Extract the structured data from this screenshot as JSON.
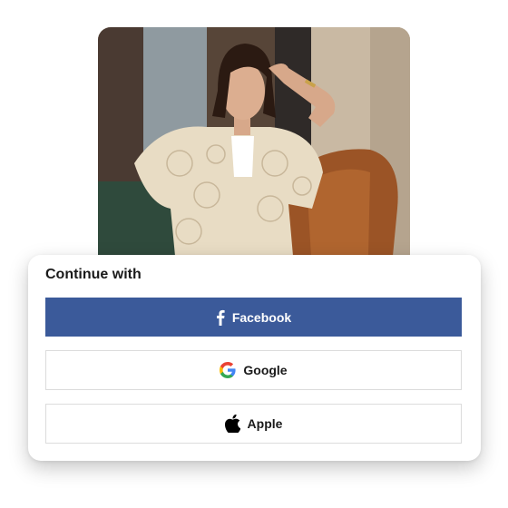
{
  "hero": {
    "alt": "Model wearing crochet shirt and rust trousers"
  },
  "signin": {
    "heading": "Continue with",
    "facebook_label": "Facebook",
    "google_label": "Google",
    "apple_label": "Apple"
  },
  "icons": {
    "facebook": "facebook-icon",
    "google": "google-icon",
    "apple": "apple-icon"
  },
  "colors": {
    "facebook_blue": "#3b5a9a",
    "border": "#dcdcdc",
    "text": "#1a1a1a"
  }
}
